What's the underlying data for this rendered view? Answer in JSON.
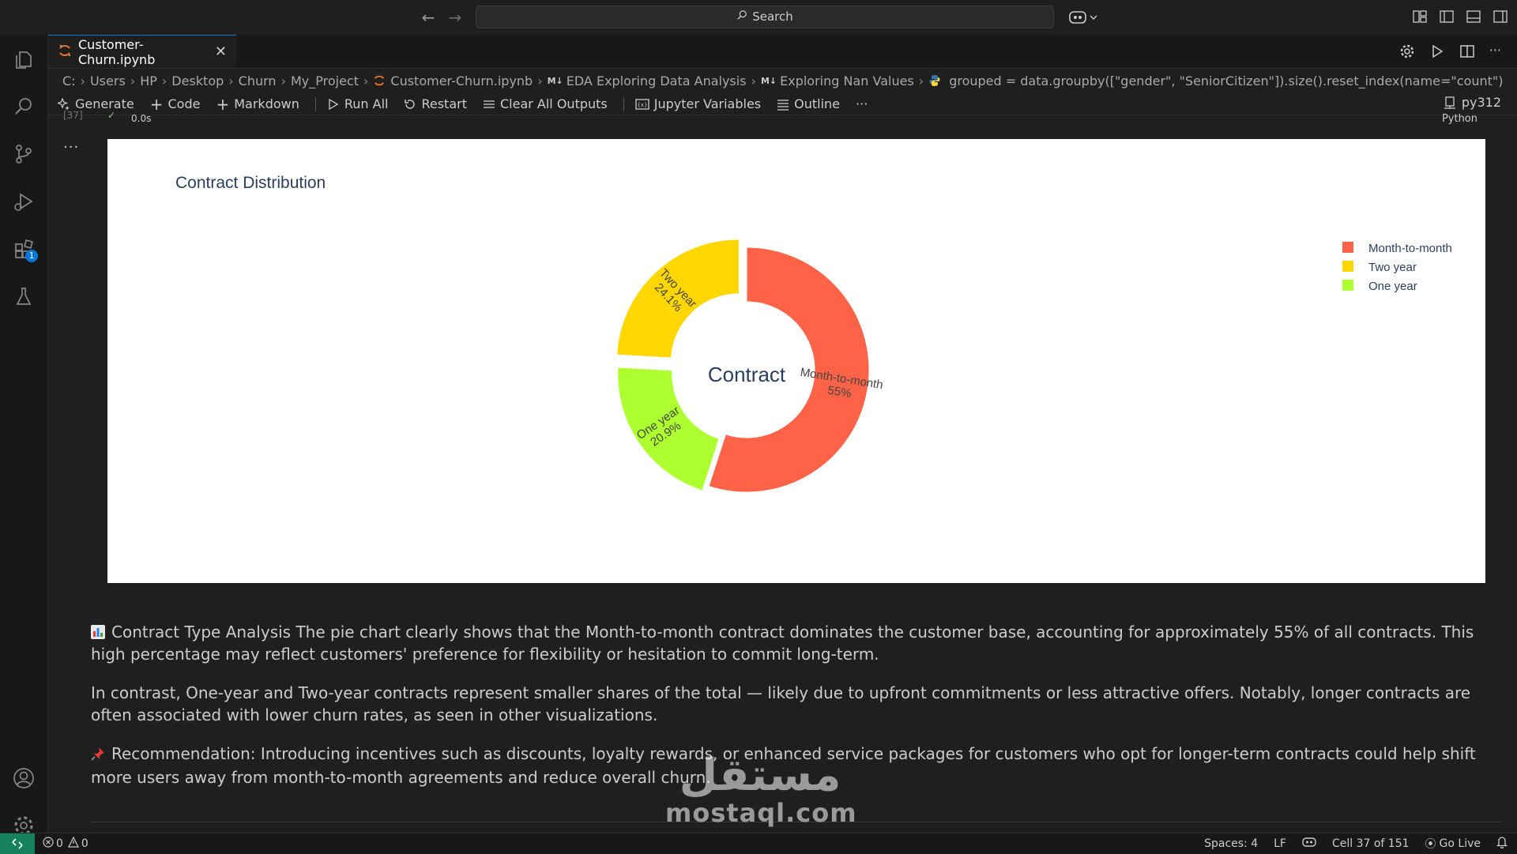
{
  "titlebar": {
    "search_placeholder": "Search"
  },
  "activity": {
    "extensions_badge": "1"
  },
  "tab": {
    "label": "Customer-Churn.ipynb"
  },
  "breadcrumb": {
    "items": [
      "C:",
      "Users",
      "HP",
      "Desktop",
      "Churn",
      "My_Project",
      "Customer-Churn.ipynb",
      "EDA Exploring Data Analysis",
      "Exploring Nan Values",
      "grouped = data.groupby([\"gender\", \"SeniorCitizen\"]).size().reset_index(name=\"count\")"
    ],
    "md_marker": "M↓"
  },
  "toolbar": {
    "generate": "Generate",
    "code": "Code",
    "markdown": "Markdown",
    "run_all": "Run All",
    "restart": "Restart",
    "clear_outputs": "Clear All Outputs",
    "jupyter_variables": "Jupyter Variables",
    "outline": "Outline",
    "more": "···",
    "kernel": "py312"
  },
  "cell": {
    "exec_count": "[37]",
    "duration": "0.0s",
    "language": "Python",
    "output_menu": "···"
  },
  "chart_data": {
    "type": "pie",
    "hole": true,
    "title": "Contract Distribution",
    "center_label": "Contract",
    "slices": [
      {
        "label": "Month-to-month",
        "percent": 55,
        "percent_text": "55%",
        "color": "#ff6347"
      },
      {
        "label": "One year",
        "percent": 20.9,
        "percent_text": "20.9%",
        "color": "#adff2f"
      },
      {
        "label": "Two year",
        "percent": 24.1,
        "percent_text": "24.1%",
        "color": "#ffd700"
      }
    ],
    "legend": [
      "Month-to-month",
      "Two year",
      "One year"
    ],
    "legend_position": "top-right"
  },
  "markdown": {
    "p1": "Contract Type Analysis The pie chart clearly shows that the Month-to-month contract dominates the customer base, accounting for approximately 55% of all contracts. This high percentage may reflect customers' preference for flexibility or hesitation to commit long-term.",
    "p2": "In contrast, One-year and Two-year contracts represent smaller shares of the total — likely due to upfront commitments or less attractive offers. Notably, longer contracts are often associated with lower churn rates, as seen in other visualizations.",
    "p3": "Recommendation: Introducing incentives such as discounts, loyalty rewards, or enhanced service packages for customers who opt for longer-term contracts could help shift more users away from month-to-month agreements and reduce overall churn."
  },
  "watermark": {
    "arabic": "مستقل",
    "latin": "mostaql.com"
  },
  "status": {
    "errors": "0",
    "warnings": "0",
    "spaces": "Spaces: 4",
    "eol": "LF",
    "cell_pos": "Cell 37 of 151",
    "go_live": "Go Live"
  },
  "colors": {
    "accent": "#0078d4",
    "remote": "#16825d"
  }
}
